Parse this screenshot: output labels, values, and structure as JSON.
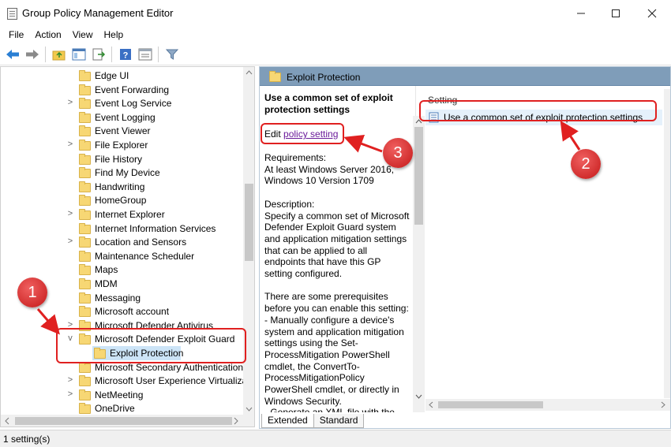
{
  "window": {
    "title": "Group Policy Management Editor",
    "minimize": "—",
    "maximize": "☐",
    "close": "✕"
  },
  "menu": [
    "File",
    "Action",
    "View",
    "Help"
  ],
  "toolbar": {
    "icons": [
      "back-arrow-icon",
      "forward-arrow-icon",
      "up-folder-icon",
      "show-hide-tree-icon",
      "export-list-icon",
      "help-icon",
      "properties-icon",
      "filter-icon"
    ]
  },
  "tree": {
    "items": [
      {
        "label": "Edge UI",
        "expander": ""
      },
      {
        "label": "Event Forwarding",
        "expander": ""
      },
      {
        "label": "Event Log Service",
        "expander": ">"
      },
      {
        "label": "Event Logging",
        "expander": ""
      },
      {
        "label": "Event Viewer",
        "expander": ""
      },
      {
        "label": "File Explorer",
        "expander": ">"
      },
      {
        "label": "File History",
        "expander": ""
      },
      {
        "label": "Find My Device",
        "expander": ""
      },
      {
        "label": "Handwriting",
        "expander": ""
      },
      {
        "label": "HomeGroup",
        "expander": ""
      },
      {
        "label": "Internet Explorer",
        "expander": ">"
      },
      {
        "label": "Internet Information Services",
        "expander": ""
      },
      {
        "label": "Location and Sensors",
        "expander": ">"
      },
      {
        "label": "Maintenance Scheduler",
        "expander": ""
      },
      {
        "label": "Maps",
        "expander": ""
      },
      {
        "label": "MDM",
        "expander": ""
      },
      {
        "label": "Messaging",
        "expander": ""
      },
      {
        "label": "Microsoft account",
        "expander": ""
      },
      {
        "label": "Microsoft Defender Antivirus",
        "expander": ">"
      },
      {
        "label": "Microsoft Defender Exploit Guard",
        "expander": "v"
      },
      {
        "label": "Exploit Protection",
        "expander": "",
        "child": true,
        "selected": true
      },
      {
        "label": "Microsoft Secondary Authentication",
        "expander": ""
      },
      {
        "label": "Microsoft User Experience Virtualization",
        "expander": ">"
      },
      {
        "label": "NetMeeting",
        "expander": ">"
      },
      {
        "label": "OneDrive",
        "expander": ""
      }
    ]
  },
  "detail": {
    "header": "Exploit Protection",
    "description_title": "Use a common set of exploit protection settings",
    "edit_prefix": "Edit ",
    "edit_link": "policy setting",
    "description_body": "Requirements:\nAt least Windows Server 2016, Windows 10 Version 1709\n\nDescription:\nSpecify a common set of Microsoft Defender Exploit Guard system and application mitigation settings that can be applied to all endpoints that have this GP setting configured.\n\nThere are some prerequisites before you can enable this setting:\n- Manually configure a device's system and application mitigation settings using the Set-ProcessMitigation PowerShell cmdlet, the ConvertTo-ProcessMitigationPolicy PowerShell cmdlet, or directly in Windows Security.\n- Generate an XML file with the",
    "list_header": "Setting",
    "list_items": [
      "Use a common set of exploit protection settings"
    ],
    "tabs": [
      "Extended",
      "Standard"
    ]
  },
  "status": "1 setting(s)",
  "callouts": [
    "1",
    "2",
    "3"
  ],
  "colors": {
    "callout": "#e02020",
    "header_blue": "#7f9db9",
    "selection": "#cce4f7",
    "link": "#6a1b9a"
  }
}
